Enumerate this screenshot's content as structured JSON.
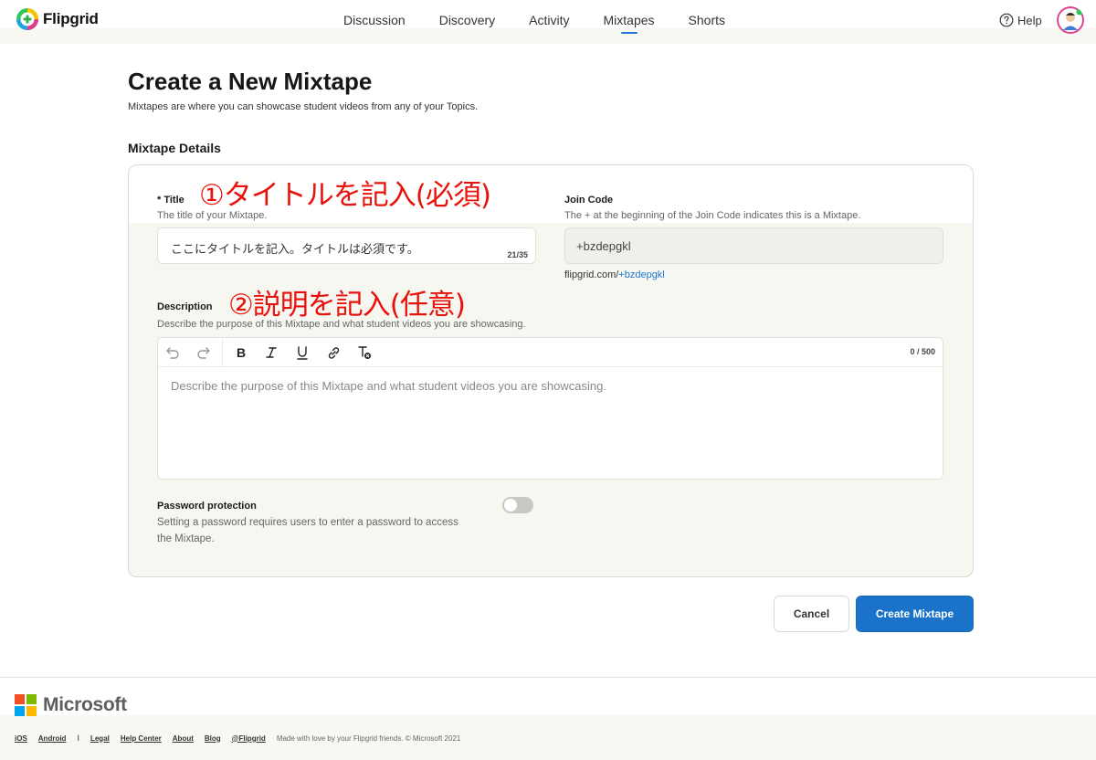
{
  "header": {
    "brand": "Flipgrid",
    "nav": [
      {
        "label": "Discussion",
        "active": false
      },
      {
        "label": "Discovery",
        "active": false
      },
      {
        "label": "Activity",
        "active": false
      },
      {
        "label": "Mixtapes",
        "active": true
      },
      {
        "label": "Shorts",
        "active": false
      }
    ],
    "help_label": "Help",
    "accent_color": "#1f77d0"
  },
  "page": {
    "title": "Create a New Mixtape",
    "subtitle": "Mixtapes are where you can showcase student videos from any of your Topics.",
    "section_title": "Mixtape Details"
  },
  "form": {
    "title_label": "* Title",
    "title_hint": "The title of your Mixtape.",
    "title_value": "ここにタイトルを記入。タイトルは必須です。",
    "title_count": "21/35",
    "join_label": "Join Code",
    "join_hint": "The + at the beginning of the Join Code indicates this is a Mixtape.",
    "join_value": "+bzdepgkl",
    "join_url_prefix": "flipgrid.com/",
    "join_url_code": "+bzdepgkl",
    "description_label": "Description",
    "description_hint": "Describe the purpose of this Mixtape and what student videos you are showcasing.",
    "description_placeholder": "Describe the purpose of this Mixtape and what student videos you are showcasing.",
    "description_count": "0 / 500",
    "toolbar_icons": [
      "undo-icon",
      "redo-icon",
      "bold-icon",
      "italic-icon",
      "underline-icon",
      "link-icon",
      "clear-format-icon"
    ],
    "password_label": "Password protection",
    "password_hint_line1": "Setting a password requires users to enter a password to access",
    "password_hint_line2": "the Mixtape.",
    "password_enabled": false
  },
  "annotations": {
    "title_note": "①タイトルを記入(必須)",
    "description_note": "②説明を記入(任意)",
    "color": "#e8120c"
  },
  "actions": {
    "cancel_label": "Cancel",
    "create_label": "Create Mixtape",
    "primary_color": "#1a73c8"
  },
  "footer": {
    "company": "Microsoft",
    "links_left": [
      "iOS",
      "Android"
    ],
    "links_right": [
      "Legal",
      "Help Center",
      "About",
      "Blog",
      "@Flipgrid"
    ],
    "divider": "I",
    "note": "Made with love by your Flipgrid friends. © Microsoft 2021"
  }
}
